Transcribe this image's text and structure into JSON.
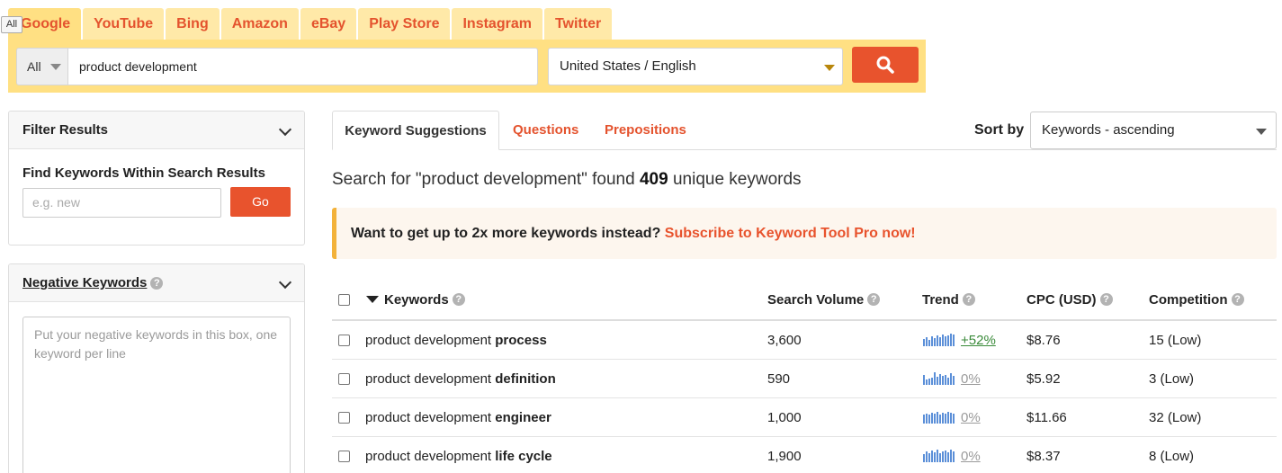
{
  "engine_tabs": [
    "Google",
    "YouTube",
    "Bing",
    "Amazon",
    "eBay",
    "Play Store",
    "Instagram",
    "Twitter"
  ],
  "tooltip": "All",
  "search": {
    "scope": "All",
    "query": "product development",
    "locale": "United States / English",
    "button_icon": "search-icon"
  },
  "filter": {
    "title": "Filter Results",
    "subtitle": "Find Keywords Within Search Results",
    "placeholder": "e.g. new",
    "go_label": "Go"
  },
  "negative": {
    "title": "Negative Keywords",
    "placeholder": "Put your negative keywords in this box, one keyword per line"
  },
  "result_tabs": [
    "Keyword Suggestions",
    "Questions",
    "Prepositions"
  ],
  "sort": {
    "label": "Sort by",
    "value": "Keywords - ascending"
  },
  "found": {
    "prefix": "Search for \"product development\" found",
    "count": "409",
    "suffix": "unique keywords"
  },
  "promo": {
    "text": "Want to get up to 2x more keywords instead?",
    "link": "Subscribe to Keyword Tool Pro now!"
  },
  "columns": [
    "Keywords",
    "Search Volume",
    "Trend",
    "CPC (USD)",
    "Competition"
  ],
  "rows": [
    {
      "prefix": "product development",
      "bold": "process",
      "volume": "3,600",
      "trend": "+52%",
      "cpc": "$8.76",
      "competition": "15 (Low)"
    },
    {
      "prefix": "product development",
      "bold": "definition",
      "volume": "590",
      "trend": "0%",
      "cpc": "$5.92",
      "competition": "3 (Low)"
    },
    {
      "prefix": "product development",
      "bold": "engineer",
      "volume": "1,000",
      "trend": "0%",
      "cpc": "$11.66",
      "competition": "32 (Low)"
    },
    {
      "prefix": "product development",
      "bold": "life cycle",
      "volume": "1,900",
      "trend": "0%",
      "cpc": "$8.37",
      "competition": "8 (Low)"
    }
  ],
  "colors": {
    "accent": "#e8532d",
    "highlight": "#ffe083",
    "trend_up": "#3a8a3a",
    "spark": "#5b8fd8"
  }
}
